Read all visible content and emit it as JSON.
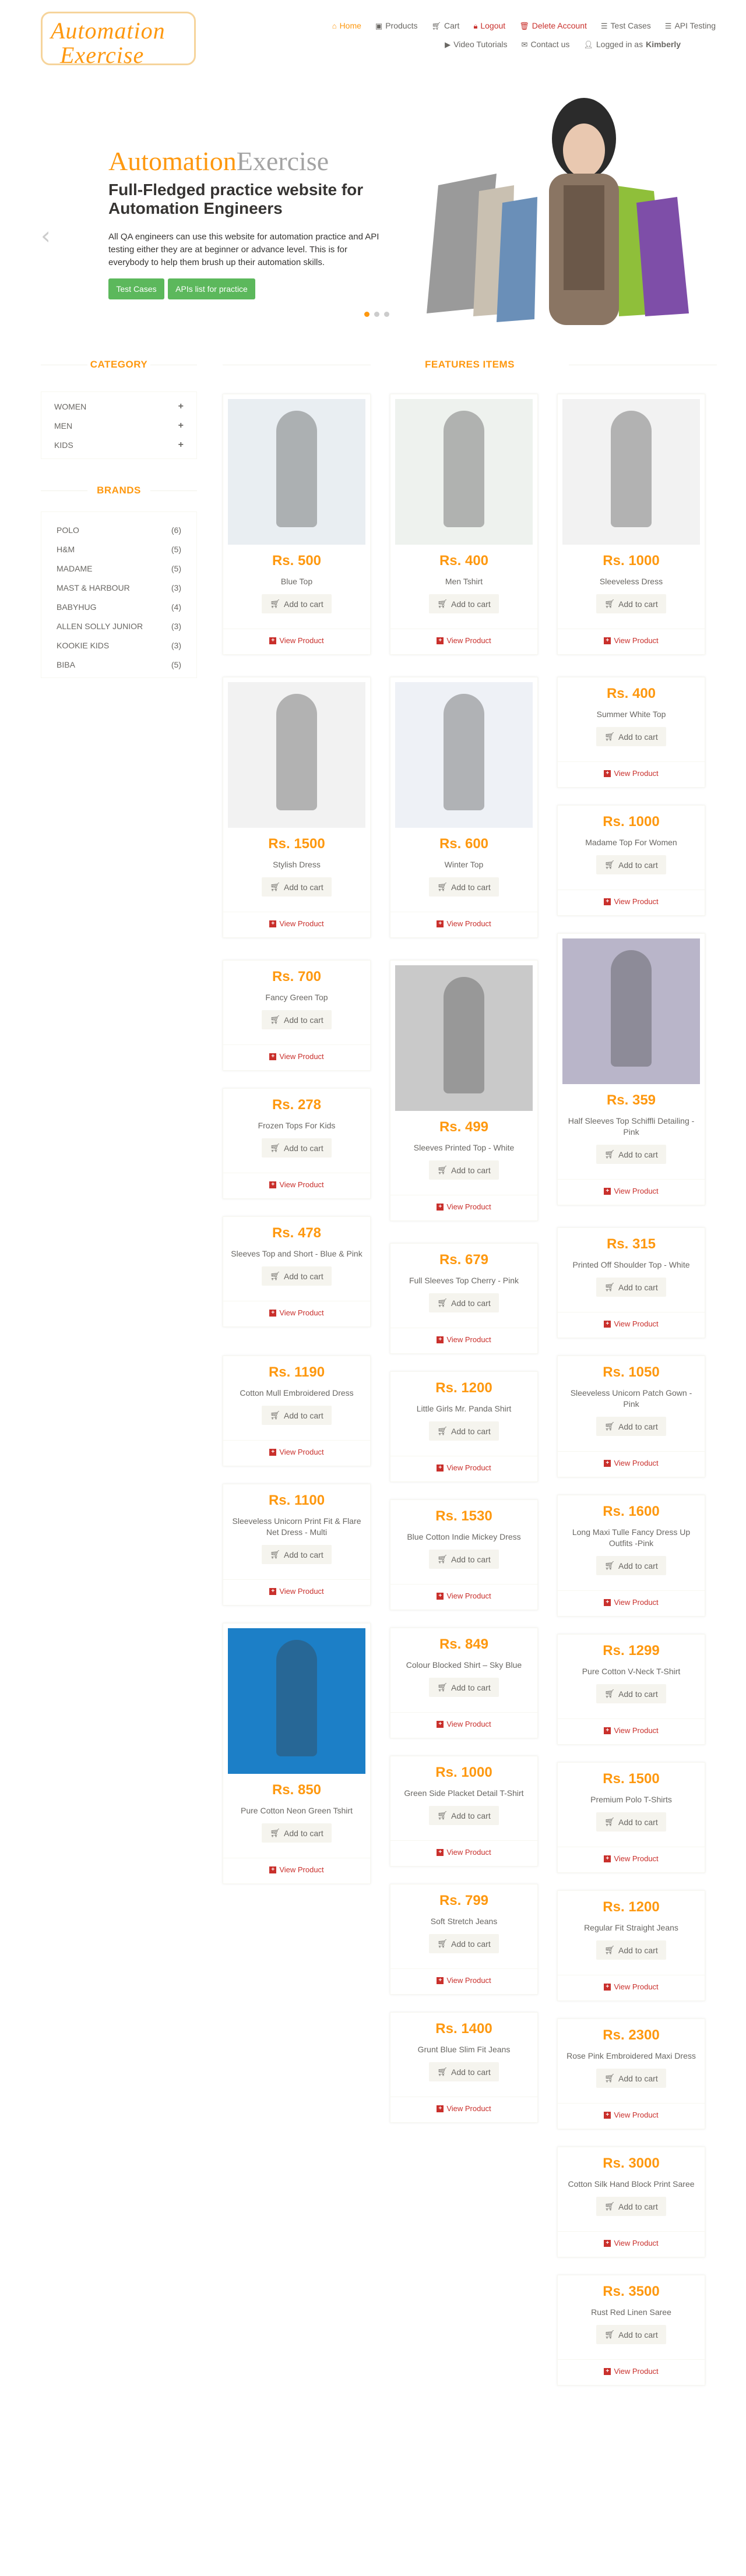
{
  "brand": {
    "line1": "Automation",
    "line2": "Exercise"
  },
  "nav": [
    {
      "label": "Home",
      "icon": "home-icon"
    },
    {
      "label": "Products",
      "icon": "tshirt-icon"
    },
    {
      "label": "Cart",
      "icon": "cart-icon"
    },
    {
      "label": "Logout",
      "icon": "lock-icon"
    },
    {
      "label": "Delete Account",
      "icon": "trash-icon"
    },
    {
      "label": "Test Cases",
      "icon": "list-icon"
    },
    {
      "label": "API Testing",
      "icon": "list-icon"
    },
    {
      "label": "Video Tutorials",
      "icon": "youtube-icon"
    },
    {
      "label": "Contact us",
      "icon": "envelope-icon"
    },
    {
      "label": "Logged in as",
      "icon": "user-icon",
      "user": "Kimberly"
    }
  ],
  "slider": {
    "title_a": "Automation",
    "title_b": "Exercise",
    "subtitle": "Full-Fledged practice website for Automation Engineers",
    "description": "All QA engineers can use this website for automation practice and API testing either they are at beginner or advance level. This is for everybody to help them brush up their automation skills.",
    "btn_tests": "Test Cases",
    "btn_apis": "APIs list for practice",
    "prev": "‹",
    "next": "›"
  },
  "category": {
    "title": "Category",
    "items": [
      "Women",
      "Men",
      "Kids"
    ]
  },
  "brands": {
    "title": "Brands",
    "items": [
      {
        "name": "Polo",
        "count": "(6)"
      },
      {
        "name": "H&M",
        "count": "(5)"
      },
      {
        "name": "Madame",
        "count": "(5)"
      },
      {
        "name": "Mast & Harbour",
        "count": "(3)"
      },
      {
        "name": "Babyhug",
        "count": "(4)"
      },
      {
        "name": "Allen Solly Junior",
        "count": "(3)"
      },
      {
        "name": "Kookie Kids",
        "count": "(3)"
      },
      {
        "name": "Biba",
        "count": "(5)"
      }
    ]
  },
  "features_title": "Features Items",
  "labels": {
    "add": "Add to cart",
    "view": "View Product"
  },
  "products": [
    {
      "price": "Rs. 500",
      "name": "Blue Top",
      "img": true,
      "color": "#e9eef2"
    },
    {
      "price": "Rs. 400",
      "name": "Men Tshirt",
      "img": true,
      "color": "#eef2ee"
    },
    {
      "price": "Rs. 1000",
      "name": "Sleeveless Dress",
      "img": true,
      "color": "#f2f2f2"
    },
    {
      "price": "Rs. 1500",
      "name": "Stylish Dress",
      "img": true,
      "color": "#f2f2f2"
    },
    {
      "price": "Rs. 600",
      "name": "Winter Top",
      "img": true,
      "color": "#eef1f6"
    },
    {
      "price": "Rs. 400",
      "name": "Summer White Top",
      "img": false
    },
    {
      "price": "Rs. 1000",
      "name": "Madame Top For Women",
      "img": false
    },
    {
      "price": "Rs. 700",
      "name": "Fancy Green Top",
      "img": false
    },
    {
      "price": "Rs. 499",
      "name": "Sleeves Printed Top - White",
      "img": true,
      "color": "#c9c9c9"
    },
    {
      "price": "Rs. 359",
      "name": "Half Sleeves Top Schiffli Detailing - Pink",
      "img": true,
      "color": "#b9b5c9"
    },
    {
      "price": "Rs. 278",
      "name": "Frozen Tops For Kids",
      "img": false
    },
    {
      "price": "Rs. 679",
      "name": "Full Sleeves Top Cherry - Pink",
      "img": false
    },
    {
      "price": "Rs. 315",
      "name": "Printed Off Shoulder Top - White",
      "img": false
    },
    {
      "price": "Rs. 478",
      "name": "Sleeves Top and Short - Blue & Pink",
      "img": false
    },
    {
      "price": "Rs. 1200",
      "name": "Little Girls Mr. Panda Shirt",
      "img": false
    },
    {
      "price": "Rs. 1050",
      "name": "Sleeveless Unicorn Patch Gown - Pink",
      "img": false
    },
    {
      "price": "Rs. 1190",
      "name": "Cotton Mull Embroidered Dress",
      "img": false
    },
    {
      "price": "Rs. 1530",
      "name": "Blue Cotton Indie Mickey Dress",
      "img": false
    },
    {
      "price": "Rs. 1600",
      "name": "Long Maxi Tulle Fancy Dress Up Outfits -Pink",
      "img": false
    },
    {
      "price": "Rs. 1100",
      "name": "Sleeveless Unicorn Print Fit & Flare Net Dress - Multi",
      "img": false
    },
    {
      "price": "Rs. 849",
      "name": "Colour Blocked Shirt – Sky Blue",
      "img": false
    },
    {
      "price": "Rs. 1299",
      "name": "Pure Cotton V-Neck T-Shirt",
      "img": false
    },
    {
      "price": "Rs. 1000",
      "name": "Green Side Placket Detail T-Shirt",
      "img": false
    },
    {
      "price": "Rs. 1500",
      "name": "Premium Polo T-Shirts",
      "img": false
    },
    {
      "price": "Rs. 850",
      "name": "Pure Cotton Neon Green Tshirt",
      "img": true,
      "color": "#1c7fc7"
    },
    {
      "price": "Rs. 799",
      "name": "Soft Stretch Jeans",
      "img": false
    },
    {
      "price": "Rs. 1200",
      "name": "Regular Fit Straight Jeans",
      "img": false
    },
    {
      "price": "Rs. 1400",
      "name": "Grunt Blue Slim Fit Jeans",
      "img": false
    },
    {
      "price": "Rs. 2300",
      "name": "Rose Pink Embroidered Maxi Dress",
      "img": false
    },
    {
      "price": "Rs. 3000",
      "name": "Cotton Silk Hand Block Print Saree",
      "img": false
    },
    {
      "price": "Rs. 3500",
      "name": "Rust Red Linen Saree",
      "img": false
    }
  ]
}
